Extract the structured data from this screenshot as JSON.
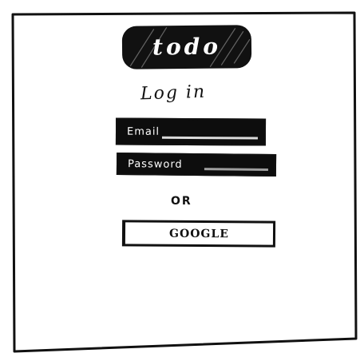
{
  "app": {
    "logo_text": "todo"
  },
  "form": {
    "heading": "Log in",
    "email_placeholder": "Email",
    "password_placeholder": "Password",
    "separator": "OR",
    "google_label": "GOOGLE"
  },
  "colors": {
    "ink": "#111111",
    "paper": "#ffffff"
  }
}
